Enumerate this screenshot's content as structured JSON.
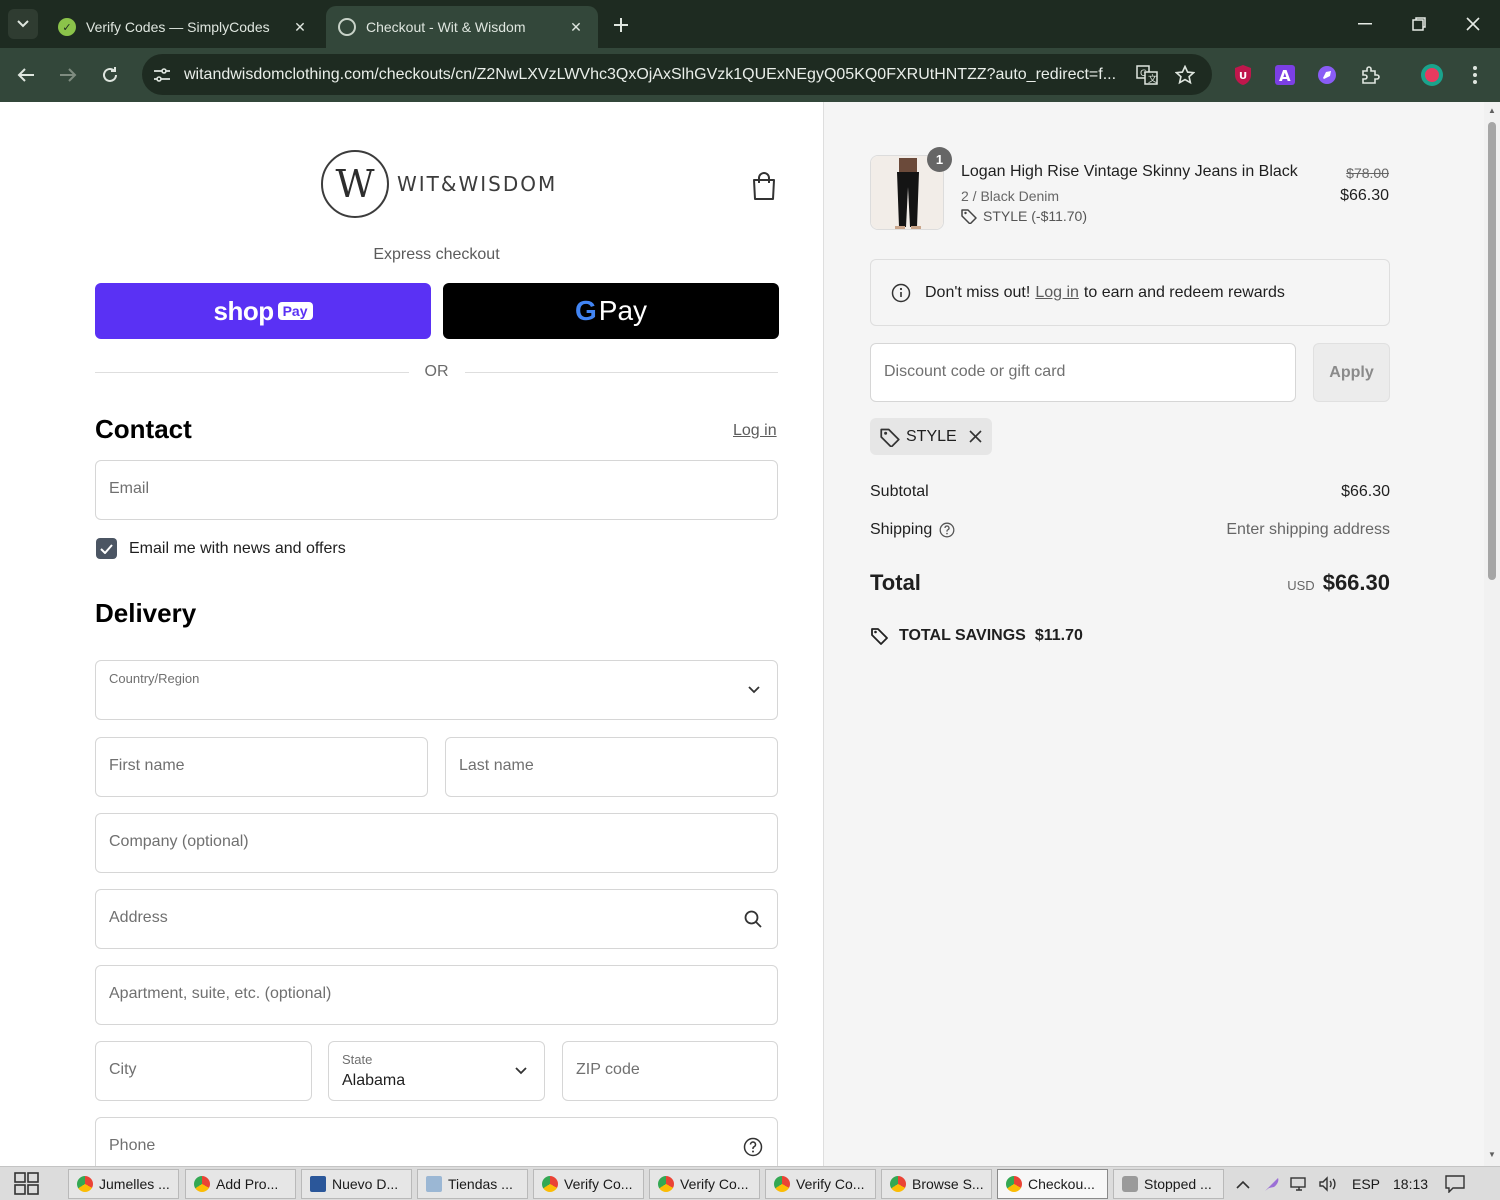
{
  "browser": {
    "tabs": [
      {
        "title": "Verify Codes — SimplyCodes",
        "active": false
      },
      {
        "title": "Checkout - Wit & Wisdom",
        "active": true
      }
    ],
    "url": "witandwisdomclothing.com/checkouts/cn/Z2NwLXVzLWVhc3QxOjAxSlhGVzk1QUExNEgyQ05KQ0FXRUtHNTZZ?auto_redirect=f..."
  },
  "checkout": {
    "logo_monogram": "W",
    "logo_text": "WIT&WISDOM",
    "express_label": "Express checkout",
    "shop_pay_wordmark": "shop",
    "shop_pay_pill": "Pay",
    "gpay_g": "G",
    "gpay_text": "Pay",
    "or_label": "OR",
    "contact_heading": "Contact",
    "login_link": "Log in",
    "email_placeholder": "Email",
    "newsletter_label": "Email me with news and offers",
    "newsletter_checked": true,
    "delivery_heading": "Delivery",
    "country_label": "Country/Region",
    "first_name_placeholder": "First name",
    "last_name_placeholder": "Last name",
    "company_placeholder": "Company (optional)",
    "address_placeholder": "Address",
    "apartment_placeholder": "Apartment, suite, etc. (optional)",
    "city_placeholder": "City",
    "state_label": "State",
    "state_value": "Alabama",
    "zip_placeholder": "ZIP code",
    "phone_placeholder": "Phone"
  },
  "summary": {
    "quantity": "1",
    "product_name": "Logan High Rise Vintage Skinny Jeans in Black",
    "variant": "2 / Black Denim",
    "discount_line": "STYLE (-$11.70)",
    "price_old": "$78.00",
    "price_new": "$66.30",
    "rewards_pre": "Don't miss out!",
    "rewards_link": "Log in",
    "rewards_post": "to earn and redeem rewards",
    "discount_placeholder": "Discount code or gift card",
    "apply_label": "Apply",
    "applied_code": "STYLE",
    "subtotal_label": "Subtotal",
    "subtotal_value": "$66.30",
    "shipping_label": "Shipping",
    "shipping_value": "Enter shipping address",
    "total_label": "Total",
    "currency": "USD",
    "total_value": "$66.30",
    "savings_label": "TOTAL SAVINGS",
    "savings_value": "$11.70"
  },
  "taskbar": {
    "items": [
      "Jumelles ...",
      "Add Pro...",
      "Nuevo D...",
      "Tiendas ...",
      "Verify Co...",
      "Verify Co...",
      "Verify Co...",
      "Browse S...",
      "Checkou...",
      "Stopped ..."
    ],
    "language": "ESP",
    "time": "18:13"
  },
  "colors": {
    "shop_pay": "#5a31f4",
    "browser_frame": "#1e2b21",
    "toolbar": "#33473a"
  }
}
